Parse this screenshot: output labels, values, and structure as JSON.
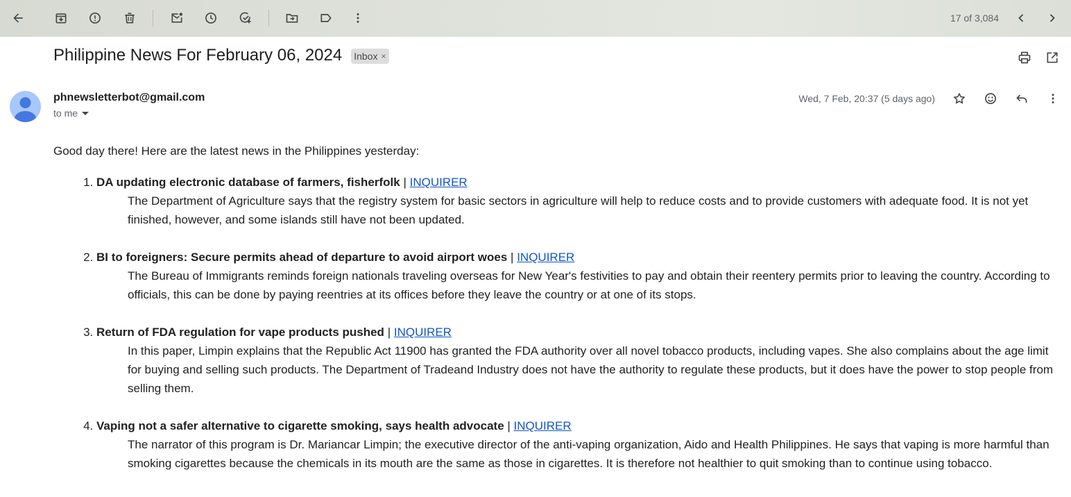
{
  "toolbar": {
    "counter": "17 of 3,084"
  },
  "subject": "Philippine News For February 06, 2024",
  "label": {
    "name": "Inbox",
    "remove": "×"
  },
  "sender": {
    "email": "phnewsletterbot@gmail.com",
    "to": "to me",
    "date": "Wed, 7 Feb, 20:37 (5 days ago)"
  },
  "body": {
    "greeting": "Good day there! Here are the latest news in the Philippines yesterday:",
    "separator": "|",
    "items": [
      {
        "title": "DA updating electronic database of farmers, fisherfolk",
        "source": "INQUIRER",
        "description": "The Department of Agriculture says that the registry system for basic sectors in agriculture will help to reduce costs and to provide customers with adequate food. It is not yet finished, however, and some islands still have not been updated."
      },
      {
        "title": "BI to foreigners: Secure permits ahead of departure to avoid airport woes",
        "source": "INQUIRER",
        "description": "The Bureau of Immigrants reminds foreign nationals traveling overseas for New Year's festivities to pay and obtain their reentery permits prior to leaving the country. According to officials, this can be done by paying reentries at its offices before they leave the country or at one of its stops."
      },
      {
        "title": "Return of FDA regulation for vape products pushed",
        "source": "INQUIRER",
        "description": "In this paper, Limpin explains that the Republic Act 11900 has granted the FDA authority over all novel tobacco products, including vapes. She also complains about the age limit for buying and selling such products. The Department of Tradeand Industry does not have the authority to regulate these products, but it does have the power to stop people from selling them."
      },
      {
        "title": "Vaping not a safer alternative to cigarette smoking, says health advocate",
        "source": "INQUIRER",
        "description": "The narrator of this program is Dr. Mariancar Limpin; the executive director of the anti-vaping organization, Aido and Health Philippines. He says that vaping is more harmful than smoking cigarettes because the chemicals in its mouth are the same as those in cigarettes. It is therefore not healthier to quit smoking than to continue using tobacco."
      }
    ]
  },
  "icons": {
    "toolbar": [
      "back-arrow-icon",
      "archive-icon",
      "report-spam-icon",
      "delete-icon",
      "mark-unread-icon",
      "snooze-icon",
      "add-task-icon",
      "move-to-icon",
      "label-icon",
      "more-vert-icon",
      "chevron-left-icon",
      "chevron-right-icon"
    ],
    "header": [
      "print-icon",
      "open-new-window-icon",
      "star-icon",
      "emoji-icon",
      "reply-icon",
      "more-vert-icon"
    ]
  },
  "colors": {
    "link": "#1155cc",
    "avatar": "#a8c7fa",
    "avatar_figure": "#4477e0",
    "toolbar_bg": "#dfe2db"
  }
}
